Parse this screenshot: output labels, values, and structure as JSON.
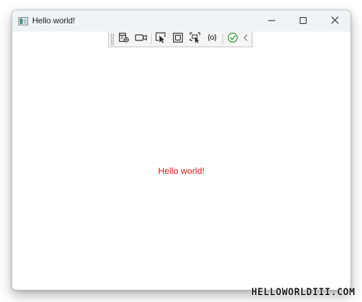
{
  "window": {
    "title": "Hello world!",
    "icon": "app-window-icon",
    "controls": {
      "minimize_icon": "minimize-icon",
      "maximize_icon": "maximize-icon",
      "close_icon": "close-icon"
    }
  },
  "debug_toolbar": {
    "buttons": [
      {
        "icon": "live-visual-tree-icon"
      },
      {
        "icon": "record-video-icon"
      },
      {
        "icon": "select-element-icon"
      },
      {
        "icon": "display-layout-adorners-icon"
      },
      {
        "icon": "track-focused-element-icon"
      },
      {
        "icon": "hot-reload-icon"
      },
      {
        "icon": "no-issues-check-icon"
      },
      {
        "icon": "collapse-chevron-icon"
      }
    ]
  },
  "content": {
    "text": "Hello world!",
    "text_color": "#e01b1b"
  },
  "watermark": "HELLOWORLDIII.COM"
}
